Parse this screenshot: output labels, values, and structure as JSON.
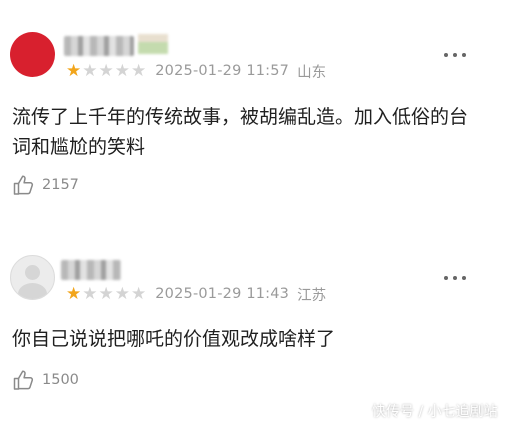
{
  "comments": [
    {
      "rating": 1,
      "stars_total": 5,
      "datetime": "2025-01-29 11:57",
      "location": "山东",
      "content": "流传了上千年的传统故事，被胡编乱造。加入低俗的台词和尴尬的笑料",
      "likes": "2157"
    },
    {
      "rating": 1,
      "stars_total": 5,
      "datetime": "2025-01-29 11:43",
      "location": "江苏",
      "content": "你自己说说把哪吒的价值观改成啥样了",
      "likes": "1500"
    }
  ],
  "watermark": "快传号 / 小七追剧站",
  "colors": {
    "star_active": "#f2a51b",
    "star_inactive": "#d4d4d4",
    "avatar_red": "#d8202e",
    "meta_text": "#9a9a9a"
  },
  "icons": {
    "like": "thumbs-up-icon",
    "more": "more-options-icon",
    "star": "star-icon"
  }
}
